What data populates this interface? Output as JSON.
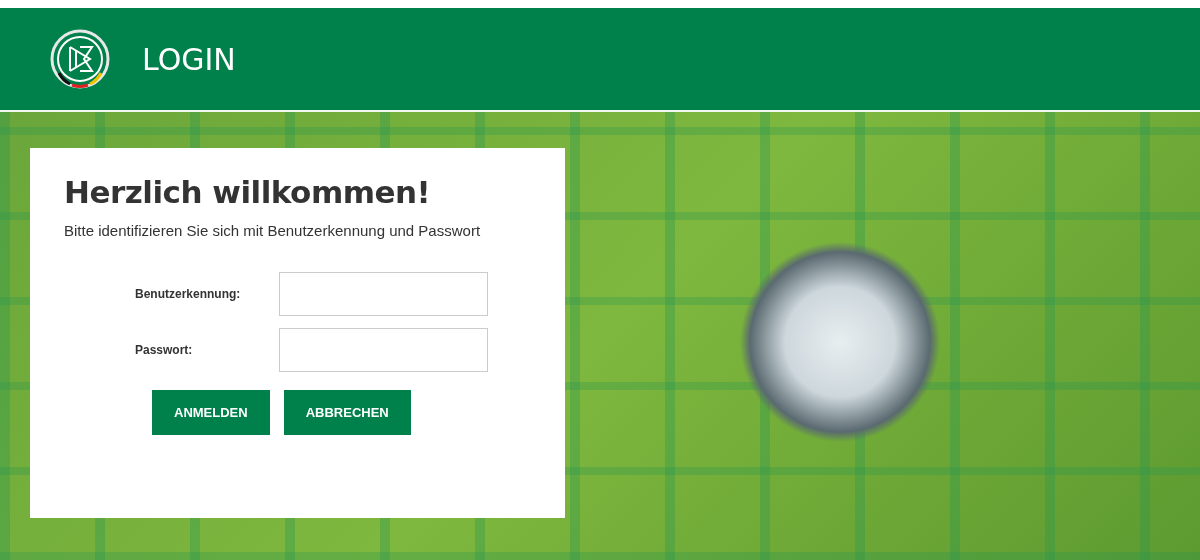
{
  "header": {
    "title": "LOGIN"
  },
  "login_card": {
    "heading": "Herzlich willkommen!",
    "text": "Bitte identifizieren Sie sich mit Benutzerkennung und Passwort",
    "fields": [
      {
        "label": "Benutzerkennung:"
      },
      {
        "label": "Passwort:"
      }
    ],
    "buttons": [
      "ANMELDEN",
      "ABBRECHEN"
    ]
  }
}
